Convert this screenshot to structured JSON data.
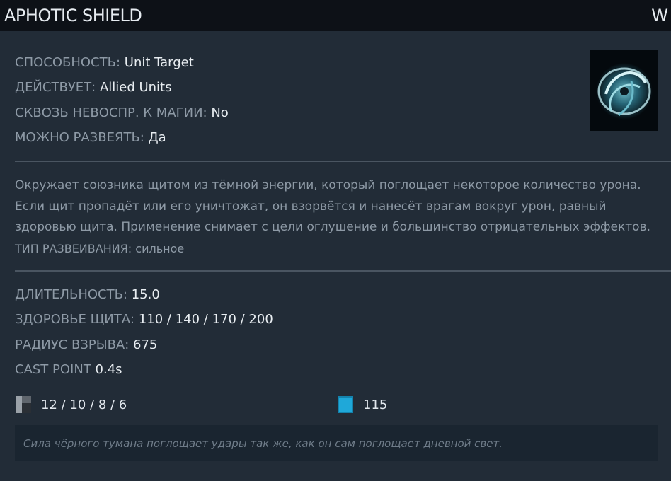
{
  "header": {
    "title": "APHOTIC SHIELD",
    "hotkey": "W"
  },
  "icon": "aphotic-shield-icon",
  "attributes": [
    {
      "key": "СПОСОБНОСТЬ: ",
      "value": "Unit Target"
    },
    {
      "key": "ДЕЙСТВУЕТ: ",
      "value": "Allied Units"
    },
    {
      "key": "СКВОЗЬ НЕВОСПР. К МАГИИ: ",
      "value": "No"
    },
    {
      "key": "МОЖНО РАЗВЕЯТЬ: ",
      "value": "Да"
    }
  ],
  "description": "Окружает союзника щитом из тёмной энергии, который поглощает некоторое количество урона. Если щит пропадёт или его уничтожат, он взорвётся и нанесёт врагам вокруг урон, равный здоровью щита. Применение снимает с цели оглушение и большинство отрицательных эффектов.",
  "dispel": {
    "key": "ТИП РАЗВЕИВАНИЯ: ",
    "value": "сильное"
  },
  "stats": [
    {
      "key": "ДЛИТЕЛЬНОСТЬ: ",
      "value": "15.0"
    },
    {
      "key": "ЗДОРОВЬЕ ЩИТА: ",
      "value": "110 / 140 / 170 / 200"
    },
    {
      "key": "РАДИУС ВЗРЫВА: ",
      "value": "675"
    },
    {
      "key": "CAST POINT ",
      "value": "0.4s"
    }
  ],
  "cooldown": "12 / 10 / 8 / 6",
  "manacost": "115",
  "lore": "Сила чёрного тумана поглощает удары так же, как он сам поглощает дневной свет.",
  "colors": {
    "background": "#222c37",
    "header": "#0d1117",
    "mana": "#1fa8d9"
  }
}
